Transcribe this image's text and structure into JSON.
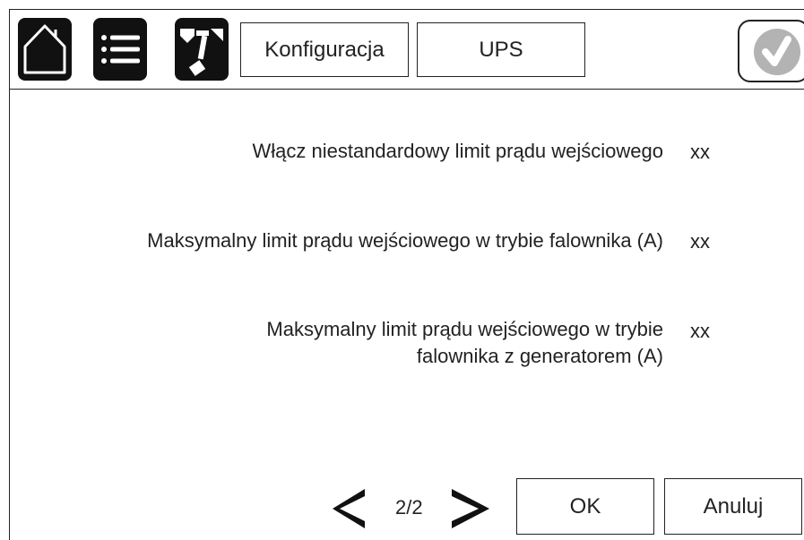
{
  "header": {
    "icons": [
      "home-icon",
      "menu-list-icon",
      "tools-icon",
      "check-icon"
    ],
    "tabs": [
      {
        "label": "Konfiguracja"
      },
      {
        "label": "UPS"
      }
    ]
  },
  "settings": [
    {
      "label": "Włącz niestandardowy limit prądu wejściowego",
      "value": "xx"
    },
    {
      "label": "Maksymalny limit prądu wejściowego w trybie falownika (A)",
      "value": "xx"
    },
    {
      "label_line1": "Maksymalny limit prądu wejściowego w trybie",
      "label_line2": "falownika z generatorem (A)",
      "value": "xx"
    }
  ],
  "pager": {
    "text": "2/2",
    "icons": [
      "chevron-left-icon",
      "chevron-right-icon"
    ]
  },
  "footer": {
    "ok_label": "OK",
    "cancel_label": "Anuluj"
  },
  "colors": {
    "icon_background": "#111111",
    "text": "#222222",
    "check_circle": "#b3b3b3"
  }
}
